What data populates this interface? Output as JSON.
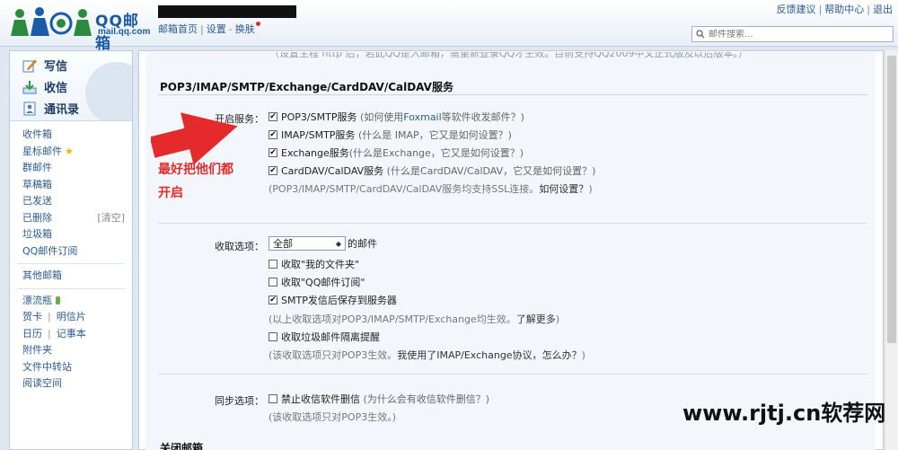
{
  "header": {
    "logo_title": "QQ邮箱",
    "logo_sub": "mail.qq.com",
    "nav": [
      "邮箱首页",
      "设置",
      "换肤"
    ],
    "top_links": [
      "反馈建议",
      "帮助中心",
      "退出"
    ],
    "search_placeholder": "邮件搜索..."
  },
  "sidebar": {
    "actions": [
      "写信",
      "收信",
      "通讯录"
    ],
    "folders_1": [
      "收件箱",
      "星标邮件",
      "群邮件",
      "草稿箱",
      "已发送",
      "已删除",
      "垃圾箱",
      "QQ邮件订阅"
    ],
    "deleted_aux": "[清空]",
    "folders_2": [
      "其他邮箱"
    ],
    "folders_3": {
      "drift": "漂流瓶",
      "card": "贺卡",
      "postcard": "明信片",
      "calendar": "日历",
      "notes": "记事本",
      "attach": "附件夹",
      "transfer": "文件中转站",
      "reading": "阅读空间"
    }
  },
  "content": {
    "cut_text": "（设置主程 http 后，若此QQ是入邮箱，需重新登录QQ才生效。目前支持QQ2009中文正式版及以后版本。）",
    "section_title": "POP3/IMAP/SMTP/Exchange/CardDAV/CalDAV服务",
    "enable_label": "开启服务：",
    "services": [
      {
        "name": "POP3/SMTP服务",
        "hint_pre": "(如何使用 ",
        "link": "Foxmail",
        "hint_post": " 等软件收发邮件？)",
        "checked": true
      },
      {
        "name": "IMAP/SMTP服务",
        "hint_pre": "(什么是 IMAP，它又是如何设置？)",
        "link": "",
        "hint_post": "",
        "checked": true
      },
      {
        "name": "Exchange服务",
        "hint_pre": "(什么是Exchange，它又是如何设置？)",
        "link": "",
        "hint_post": "",
        "checked": true
      },
      {
        "name": "CardDAV/CalDAV服务",
        "hint_pre": "(什么是CardDAV/CalDAV，它又是如何设置？)",
        "link": "",
        "hint_post": "",
        "checked": true
      }
    ],
    "ssl_note_pre": "(POP3/IMAP/SMTP/CardDAV/CalDAV服务均支持SSL连接。",
    "ssl_note_link": "如何设置？",
    "ssl_note_post": ")",
    "receive_label": "收取选项：",
    "receive_select": "全部",
    "receive_suffix": "的邮件",
    "receive_opts": [
      {
        "label": "收取\"我的文件夹\"",
        "checked": false
      },
      {
        "label": "收取\"QQ邮件订阅\"",
        "checked": false
      },
      {
        "label": "SMTP发信后保存到服务器",
        "checked": true
      }
    ],
    "receive_note_pre": "(以上收取选项对POP3/IMAP/SMTP/Exchange均生效。",
    "receive_note_link": "了解更多",
    "receive_note_post": ")",
    "spam_opt": "收取垃圾邮件隔离提醒",
    "spam_note_pre": "(该收取选项只对POP3生效。",
    "spam_note_link": "我使用了IMAP/Exchange协议，怎么办？",
    "spam_note_post": ")",
    "sync_label": "同步选项：",
    "sync_opt": "禁止收信软件删信",
    "sync_hint": "(为什么会有收信软件删信？)",
    "sync_note": "(该收取选项只对POP3生效。)",
    "bottom_title": "关闭邮箱",
    "annotation_line1": "最好把他们都",
    "annotation_line2": "开启"
  },
  "watermark": "www.rjtj.cn软荐网",
  "colors": {
    "annotation": "#e22b2b",
    "link": "#2b5a94",
    "brand": "#1b5aa8"
  }
}
